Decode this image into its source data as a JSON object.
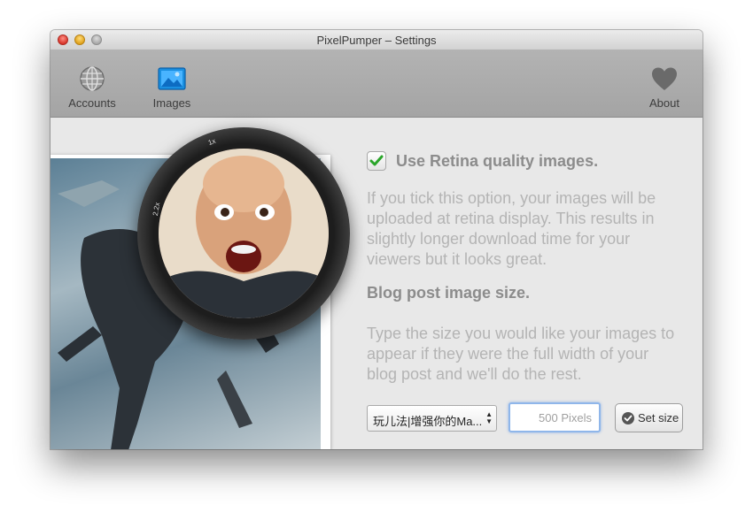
{
  "window": {
    "title": "PixelPumper – Settings"
  },
  "toolbar": {
    "accounts": {
      "label": "Accounts",
      "icon": "globe-icon"
    },
    "images": {
      "label": "Images",
      "icon": "picture-icon",
      "selected": true
    },
    "about": {
      "label": "About",
      "icon": "heart-icon"
    }
  },
  "preview": {
    "zoom_labels": {
      "min": "2.2x",
      "max": "1x"
    }
  },
  "retina": {
    "checked": true,
    "label": "Use Retina quality images.",
    "description": [
      "If you tick this option, your images will be",
      "uploaded at retina display. This results in",
      "slightly longer download time for your",
      "viewers but it looks great."
    ]
  },
  "blog_size": {
    "heading": "Blog post image size.",
    "description": [
      "Type the size you would like your images to",
      "appear if they were the full width of your",
      "blog post and we'll do the rest."
    ],
    "select_value": "玩儿法|增强你的Ma...",
    "size_value": "500",
    "size_unit": "Pixels",
    "set_button": "Set size"
  },
  "colors": {
    "accent_blue": "#1a8fe0",
    "checkmark_green": "#2aa52a"
  }
}
